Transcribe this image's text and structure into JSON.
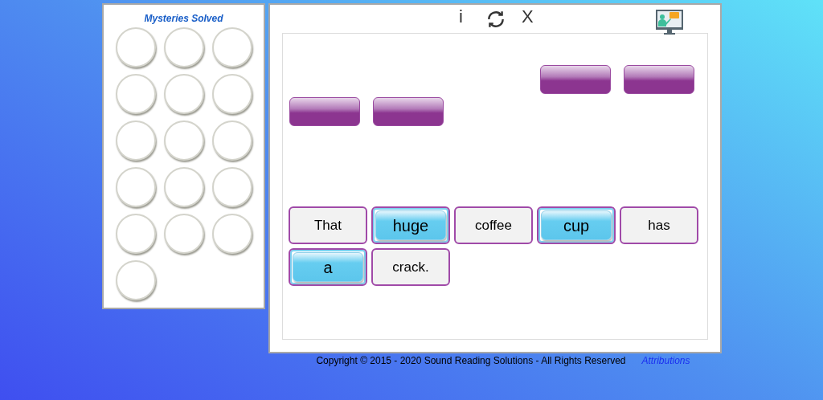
{
  "sidebar": {
    "title": "Mysteries Solved",
    "badges": [
      {
        "kind": "empty"
      },
      {
        "kind": "empty"
      },
      {
        "kind": "empty"
      },
      {
        "kind": "empty"
      },
      {
        "kind": "empty"
      },
      {
        "kind": "empty"
      },
      {
        "kind": "empty"
      },
      {
        "kind": "empty"
      },
      {
        "kind": "empty"
      },
      {
        "kind": "empty"
      },
      {
        "kind": "empty"
      },
      {
        "kind": "empty"
      },
      {
        "kind": "empty"
      },
      {
        "kind": "empty"
      },
      {
        "kind": "empty"
      },
      {
        "kind": "empty"
      }
    ]
  },
  "toolbar": {
    "info": "i",
    "close": "X"
  },
  "answer_slots": [
    [
      {
        "kind": "empty"
      },
      {
        "kind": "empty"
      }
    ],
    [
      {
        "kind": "empty"
      },
      {
        "kind": "empty"
      }
    ]
  ],
  "words": [
    {
      "text": "That",
      "selected": false
    },
    {
      "text": "huge",
      "selected": true
    },
    {
      "text": "coffee",
      "selected": false
    },
    {
      "text": "cup",
      "selected": true
    },
    {
      "text": "has",
      "selected": false
    },
    {
      "text": "a",
      "selected": true
    },
    {
      "text": "crack.",
      "selected": false
    }
  ],
  "footer": {
    "copyright": "Copyright © 2015 - 2020 Sound Reading Solutions - All Rights Reserved",
    "link": "Attributions"
  }
}
